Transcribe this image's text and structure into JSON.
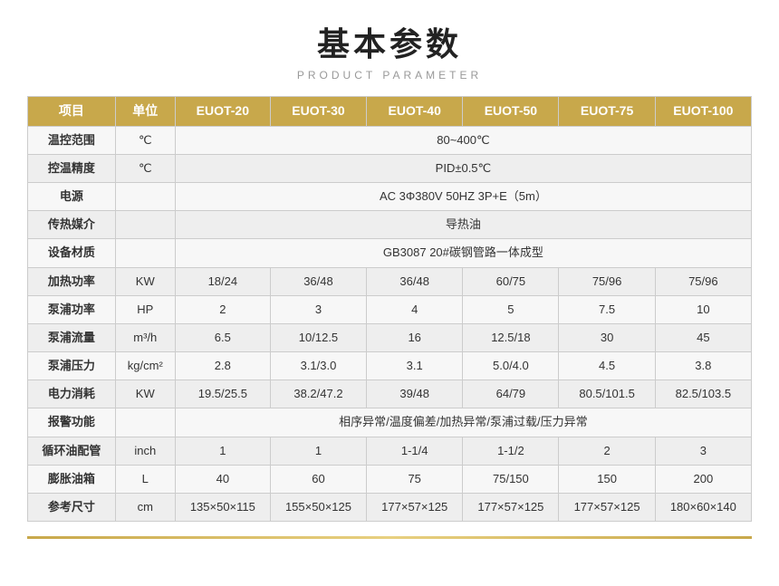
{
  "header": {
    "title": "基本参数",
    "subtitle": "PRODUCT PARAMETER"
  },
  "table": {
    "columns": [
      "项目",
      "单位",
      "EUOT-20",
      "EUOT-30",
      "EUOT-40",
      "EUOT-50",
      "EUOT-75",
      "EUOT-100"
    ],
    "rows": [
      {
        "label": "温控范围",
        "unit": "℃",
        "span": true,
        "spanValue": "80~400℃"
      },
      {
        "label": "控温精度",
        "unit": "℃",
        "span": true,
        "spanValue": "PID±0.5℃"
      },
      {
        "label": "电源",
        "unit": "",
        "span": true,
        "spanValue": "AC 3Φ380V 50HZ  3P+E（5m）"
      },
      {
        "label": "传热媒介",
        "unit": "",
        "span": true,
        "spanValue": "导热油"
      },
      {
        "label": "设备材质",
        "unit": "",
        "span": true,
        "spanValue": "GB3087    20#碳钢管路一体成型"
      },
      {
        "label": "加热功率",
        "unit": "KW",
        "span": false,
        "values": [
          "18/24",
          "36/48",
          "36/48",
          "60/75",
          "75/96",
          "75/96"
        ]
      },
      {
        "label": "泵浦功率",
        "unit": "HP",
        "span": false,
        "values": [
          "2",
          "3",
          "4",
          "5",
          "7.5",
          "10"
        ]
      },
      {
        "label": "泵浦流量",
        "unit": "m³/h",
        "span": false,
        "values": [
          "6.5",
          "10/12.5",
          "16",
          "12.5/18",
          "30",
          "45"
        ]
      },
      {
        "label": "泵浦压力",
        "unit": "kg/cm²",
        "span": false,
        "values": [
          "2.8",
          "3.1/3.0",
          "3.1",
          "5.0/4.0",
          "4.5",
          "3.8"
        ]
      },
      {
        "label": "电力消耗",
        "unit": "KW",
        "span": false,
        "values": [
          "19.5/25.5",
          "38.2/47.2",
          "39/48",
          "64/79",
          "80.5/101.5",
          "82.5/103.5"
        ]
      },
      {
        "label": "报警功能",
        "unit": "",
        "span": true,
        "spanValue": "相序异常/温度偏差/加热异常/泵浦过载/压力异常"
      },
      {
        "label": "循环油配管",
        "unit": "inch",
        "span": false,
        "values": [
          "1",
          "1",
          "1-1/4",
          "1-1/2",
          "2",
          "3"
        ]
      },
      {
        "label": "膨胀油箱",
        "unit": "L",
        "span": false,
        "values": [
          "40",
          "60",
          "75",
          "75/150",
          "150",
          "200"
        ]
      },
      {
        "label": "参考尺寸",
        "unit": "cm",
        "span": false,
        "values": [
          "135×50×115",
          "155×50×125",
          "177×57×125",
          "177×57×125",
          "177×57×125",
          "180×60×140"
        ]
      }
    ]
  }
}
